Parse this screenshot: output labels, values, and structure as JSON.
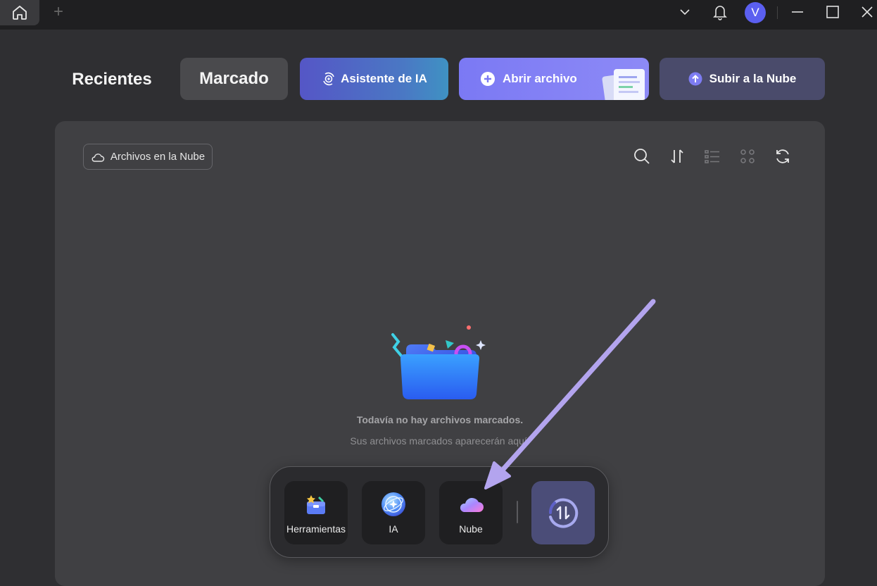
{
  "titlebar": {
    "new_tab_symbol": "+",
    "avatar_initial": "V"
  },
  "tabs": {
    "recent_label": "Recientes",
    "marked_label": "Marcado"
  },
  "actions": {
    "ai_assistant_label": "Asistente de IA",
    "open_file_label": "Abrir archivo",
    "upload_cloud_label": "Subir a la Nube"
  },
  "panel": {
    "cloud_files_label": "Archivos en la Nube",
    "toolbar_icons": [
      "search-icon",
      "sort-icon",
      "list-view-icon",
      "grid-view-icon",
      "refresh-icon"
    ],
    "empty_title": "Todavía no hay archivos marcados.",
    "empty_subtitle": "Sus archivos marcados aparecerán aquí."
  },
  "dock": {
    "items": [
      {
        "label": "Herramientas",
        "icon": "toolbox-icon"
      },
      {
        "label": "IA",
        "icon": "ai-orb-icon"
      },
      {
        "label": "Nube",
        "icon": "cloud-icon"
      }
    ],
    "convert_icon": "convert-icon"
  },
  "colors": {
    "ai_button": "#4a78c4",
    "open_button": "#7b79f4",
    "upload_button": "#4a4b6b",
    "arrow": "#b3a4ee",
    "avatar": "#5b5ff0"
  }
}
